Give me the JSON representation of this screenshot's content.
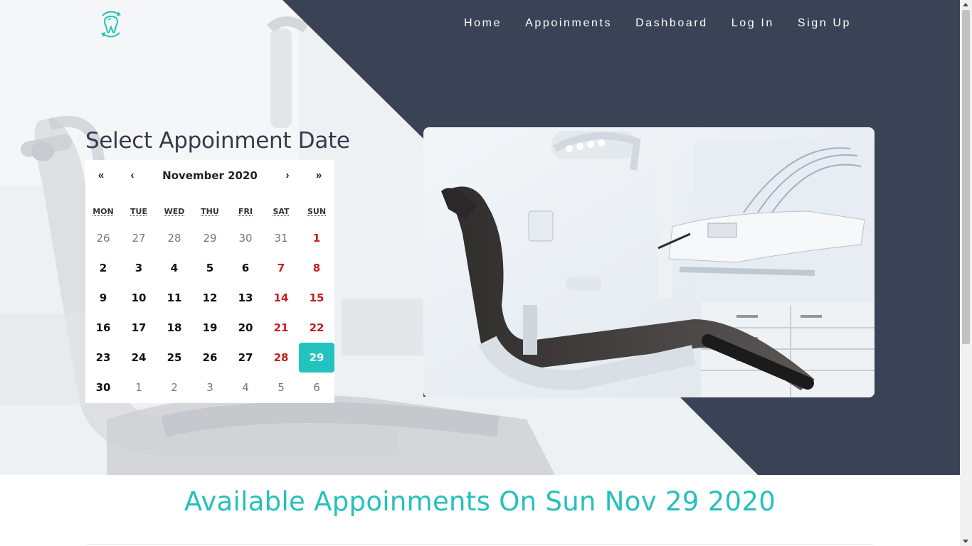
{
  "nav": {
    "items": [
      {
        "label": "Home"
      },
      {
        "label": "Appoinments"
      },
      {
        "label": "Dashboard"
      },
      {
        "label": "Log In"
      },
      {
        "label": "Sign Up"
      }
    ]
  },
  "logo": {
    "icon": "tooth-icon",
    "color": "#25c1bc"
  },
  "calendar": {
    "title": "Select Appoinment Date",
    "prev_year": "«",
    "prev_month": "‹",
    "month_label": "November 2020",
    "next_month": "›",
    "next_year": "»",
    "weekdays": [
      "MON",
      "TUE",
      "WED",
      "THU",
      "FRI",
      "SAT",
      "SUN"
    ],
    "days": [
      {
        "n": "26",
        "kind": "other"
      },
      {
        "n": "27",
        "kind": "other"
      },
      {
        "n": "28",
        "kind": "other"
      },
      {
        "n": "29",
        "kind": "other"
      },
      {
        "n": "30",
        "kind": "other"
      },
      {
        "n": "31",
        "kind": "other"
      },
      {
        "n": "1",
        "kind": "weekend"
      },
      {
        "n": "2",
        "kind": "normal"
      },
      {
        "n": "3",
        "kind": "normal"
      },
      {
        "n": "4",
        "kind": "normal"
      },
      {
        "n": "5",
        "kind": "normal"
      },
      {
        "n": "6",
        "kind": "normal"
      },
      {
        "n": "7",
        "kind": "weekend"
      },
      {
        "n": "8",
        "kind": "weekend"
      },
      {
        "n": "9",
        "kind": "normal"
      },
      {
        "n": "10",
        "kind": "normal"
      },
      {
        "n": "11",
        "kind": "normal"
      },
      {
        "n": "12",
        "kind": "normal"
      },
      {
        "n": "13",
        "kind": "normal"
      },
      {
        "n": "14",
        "kind": "weekend"
      },
      {
        "n": "15",
        "kind": "weekend"
      },
      {
        "n": "16",
        "kind": "normal"
      },
      {
        "n": "17",
        "kind": "normal"
      },
      {
        "n": "18",
        "kind": "normal"
      },
      {
        "n": "19",
        "kind": "normal"
      },
      {
        "n": "20",
        "kind": "normal"
      },
      {
        "n": "21",
        "kind": "weekend"
      },
      {
        "n": "22",
        "kind": "weekend"
      },
      {
        "n": "23",
        "kind": "normal"
      },
      {
        "n": "24",
        "kind": "normal"
      },
      {
        "n": "25",
        "kind": "normal"
      },
      {
        "n": "26",
        "kind": "normal"
      },
      {
        "n": "27",
        "kind": "normal"
      },
      {
        "n": "28",
        "kind": "weekend"
      },
      {
        "n": "29",
        "kind": "selected"
      },
      {
        "n": "30",
        "kind": "normal"
      },
      {
        "n": "1",
        "kind": "other"
      },
      {
        "n": "2",
        "kind": "other"
      },
      {
        "n": "3",
        "kind": "other"
      },
      {
        "n": "4",
        "kind": "other"
      },
      {
        "n": "5",
        "kind": "other"
      },
      {
        "n": "6",
        "kind": "other"
      }
    ],
    "selected_color": "#22c3bf",
    "weekend_color": "#c41e1e"
  },
  "available": {
    "heading": "Available Appoinments On Sun Nov 29 2020"
  },
  "colors": {
    "dark": "#3a4255",
    "accent": "#25c1bc"
  }
}
